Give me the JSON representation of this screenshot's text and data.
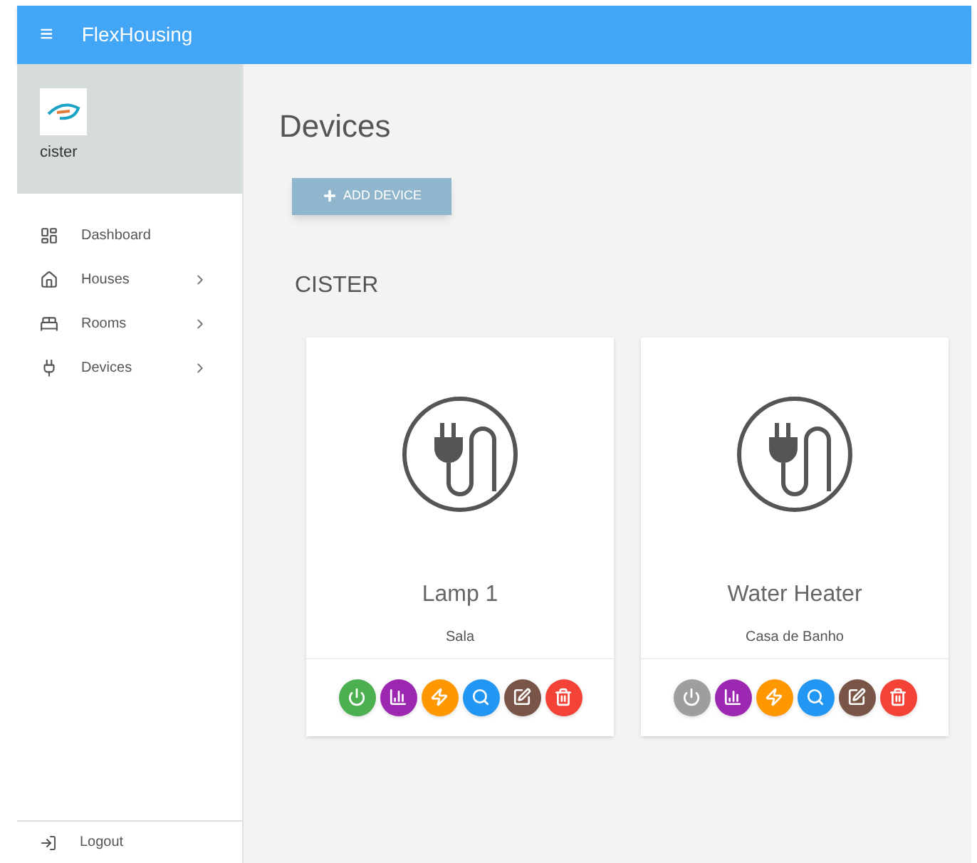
{
  "app_bar": {
    "menu_icon": "≡",
    "title": "FlexHousing"
  },
  "profile": {
    "name": "cister"
  },
  "nav": [
    {
      "label": "Dashboard",
      "has_submenu": false
    },
    {
      "label": "Houses",
      "has_submenu": true
    },
    {
      "label": "Rooms",
      "has_submenu": true
    },
    {
      "label": "Devices",
      "has_submenu": true
    }
  ],
  "logout": {
    "label": "Logout"
  },
  "page": {
    "title": "Devices",
    "add_button": "ADD DEVICE",
    "house": "CISTER"
  },
  "devices": [
    {
      "name": "Lamp 1",
      "room": "Sala",
      "on": true
    },
    {
      "name": "Water Heater",
      "room": "Casa de Banho",
      "on": false
    }
  ]
}
